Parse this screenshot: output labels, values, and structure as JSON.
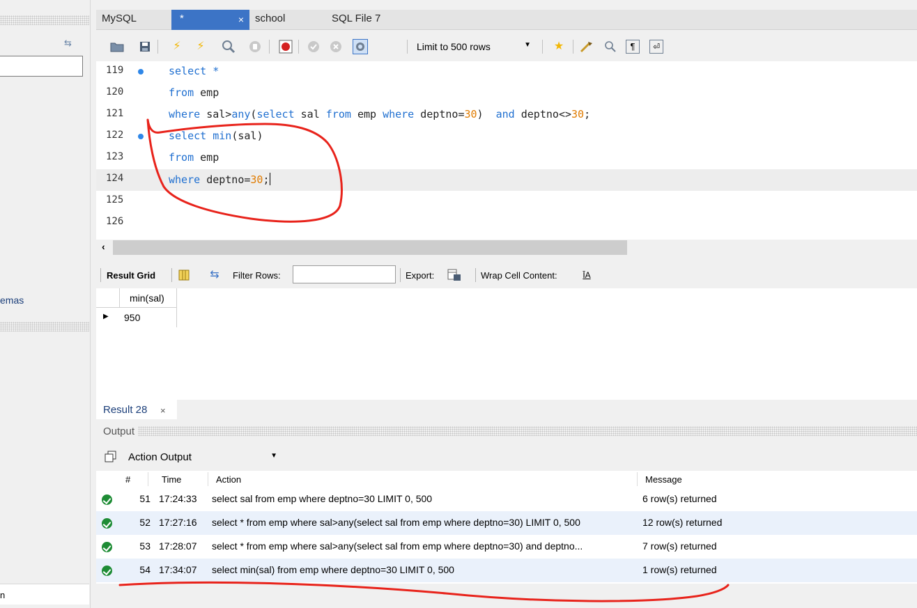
{
  "sidebar": {
    "tab_label": "emas",
    "bottom_label": "n"
  },
  "tabs": [
    {
      "label": "MySQL"
    },
    {
      "label": "*",
      "close": "×"
    },
    {
      "label": "school"
    },
    {
      "label": "SQL File 7"
    }
  ],
  "toolbar": {
    "limit": "Limit to 500 rows"
  },
  "editor": {
    "lines": [
      {
        "num": "119",
        "code": "select *"
      },
      {
        "num": "120",
        "code": "from emp"
      },
      {
        "num": "121",
        "code": "where sal>any(select sal from emp where deptno=30)  and deptno<>30;"
      },
      {
        "num": "122",
        "code": "select min(sal)"
      },
      {
        "num": "123",
        "code": "from emp"
      },
      {
        "num": "124",
        "code": "where deptno=30;"
      },
      {
        "num": "125",
        "code": ""
      },
      {
        "num": "126",
        "code": ""
      }
    ]
  },
  "result_toolbar": {
    "grid_label": "Result Grid",
    "filter_label": "Filter Rows:",
    "export_label": "Export:",
    "wrap_label": "Wrap Cell Content:"
  },
  "result_grid": {
    "column": "min(sal)",
    "value": "950"
  },
  "result_tab": {
    "label": "Result 28",
    "close": "×"
  },
  "output": {
    "label": "Output",
    "select": "Action Output",
    "headers": {
      "num": "#",
      "time": "Time",
      "action": "Action",
      "message": "Message"
    },
    "rows": [
      {
        "num": "51",
        "time": "17:24:33",
        "action": "select sal from emp where deptno=30 LIMIT 0, 500",
        "message": "6 row(s) returned"
      },
      {
        "num": "52",
        "time": "17:27:16",
        "action": "select * from emp where sal>any(select sal from emp where deptno=30) LIMIT 0, 500",
        "message": "12 row(s) returned"
      },
      {
        "num": "53",
        "time": "17:28:07",
        "action": "select * from emp where sal>any(select sal from emp where deptno=30)  and deptno...",
        "message": "7 row(s) returned"
      },
      {
        "num": "54",
        "time": "17:34:07",
        "action": "select min(sal)  from emp where deptno=30 LIMIT 0, 500",
        "message": "1 row(s) returned"
      }
    ]
  },
  "colors": {
    "active_tab": "#3c74c6",
    "keyword": "#1f6fd0",
    "number": "#e07b00",
    "annotation": "#e8231b",
    "success": "#1e8c35"
  }
}
